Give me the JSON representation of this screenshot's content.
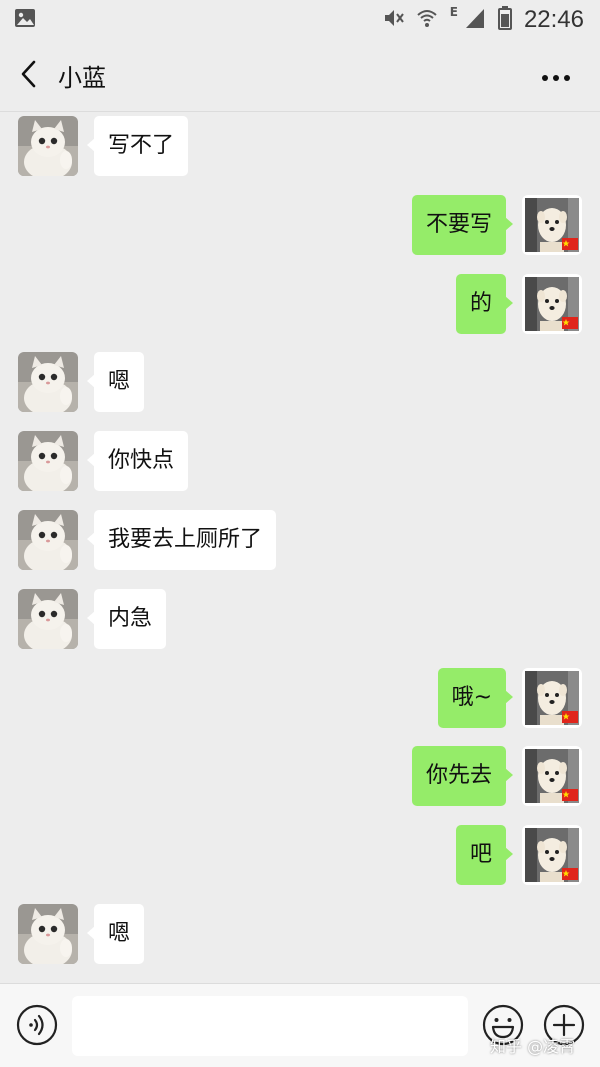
{
  "status_bar": {
    "time": "22:46",
    "network_type": "E",
    "icons": [
      "gallery-icon",
      "mute-icon",
      "wifi-icon",
      "signal-icon",
      "battery-icon"
    ]
  },
  "header": {
    "back_icon": "chevron-left-icon",
    "title": "小蓝",
    "more_icon": "more-dots-icon"
  },
  "messages": [
    {
      "side": "left",
      "text": "写不了"
    },
    {
      "side": "right",
      "text": "不要写"
    },
    {
      "side": "right",
      "text": "的"
    },
    {
      "side": "left",
      "text": "嗯"
    },
    {
      "side": "left",
      "text": "你快点"
    },
    {
      "side": "left",
      "text": "我要去上厕所了"
    },
    {
      "side": "left",
      "text": "内急"
    },
    {
      "side": "right",
      "text": "哦~"
    },
    {
      "side": "right",
      "text": "你先去"
    },
    {
      "side": "right",
      "text": "吧"
    },
    {
      "side": "left",
      "text": "嗯"
    }
  ],
  "input_bar": {
    "text_value": "",
    "voice_icon": "voice-icon",
    "emoji_icon": "emoji-icon",
    "plus_icon": "plus-icon"
  },
  "watermark": "知乎 @凌霄",
  "colors": {
    "background": "#ededed",
    "bubble_self": "#95ec69",
    "bubble_other": "#ffffff",
    "input_bar": "#f7f7f7"
  }
}
